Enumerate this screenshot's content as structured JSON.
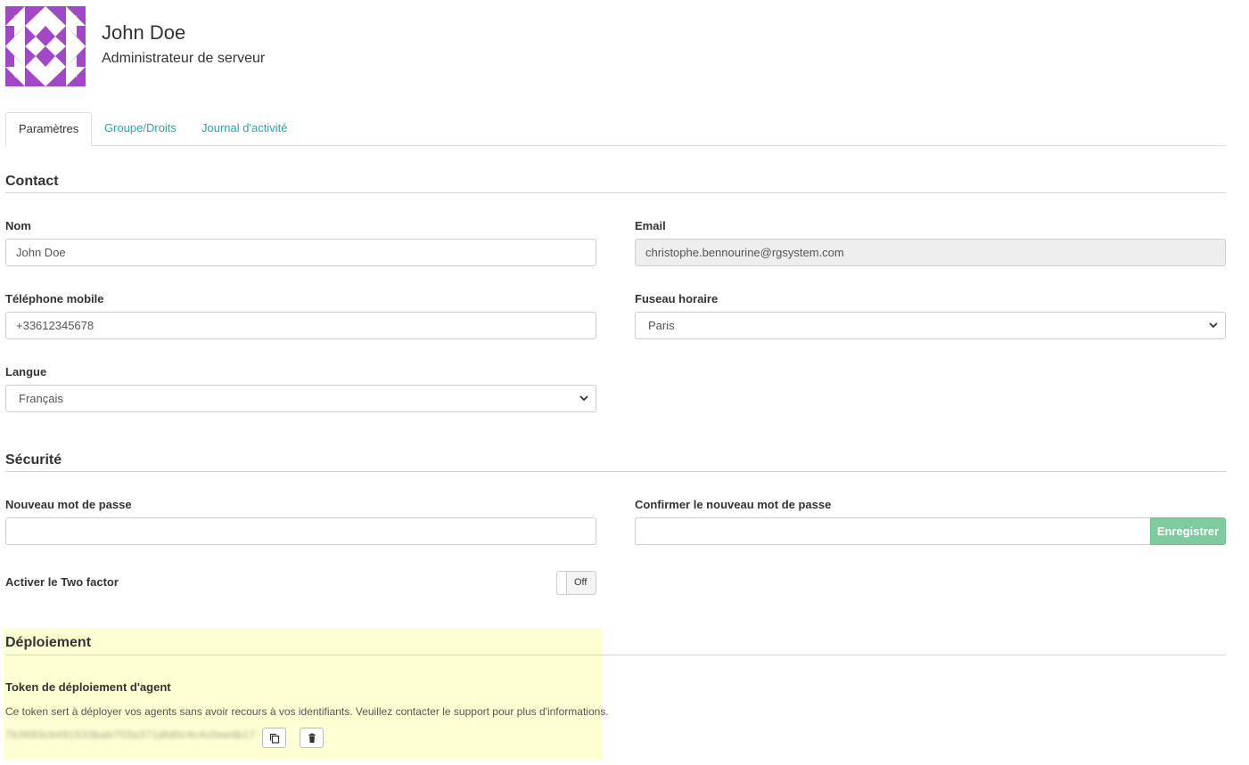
{
  "user": {
    "name": "John Doe",
    "role": "Administrateur de serveur"
  },
  "tabs": [
    {
      "label": "Paramètres",
      "active": true
    },
    {
      "label": "Groupe/Droits",
      "active": false
    },
    {
      "label": "Journal d'activité",
      "active": false
    }
  ],
  "contact": {
    "title": "Contact",
    "nom_label": "Nom",
    "nom_value": "John Doe",
    "email_label": "Email",
    "email_value": "christophe.bennourine@rgsystem.com",
    "phone_label": "Téléphone mobile",
    "phone_value": "+33612345678",
    "timezone_label": "Fuseau horaire",
    "timezone_value": "Paris",
    "langue_label": "Langue",
    "langue_value": "Français"
  },
  "security": {
    "title": "Sécurité",
    "new_password_label": "Nouveau mot de passe",
    "confirm_password_label": "Confirmer le nouveau mot de passe",
    "save_label": "Enregistrer",
    "two_factor_label": "Activer le Two factor",
    "two_factor_state": "Off"
  },
  "deployment": {
    "title": "Déploiement",
    "token_label": "Token de déploiement d'agent",
    "token_hint": "Ce token sert à déployer vos agents sans avoir recours à vos identifiants. Veuillez contacter le support pour plus d'informations.",
    "token_value": "7b3693cb491533bab703a371dfd0c4c4c0eedb17"
  },
  "colors": {
    "accent": "#26a6a6",
    "save_button": "#7dcb9e",
    "avatar": "#a347c9",
    "highlight": "#ffffd4"
  }
}
